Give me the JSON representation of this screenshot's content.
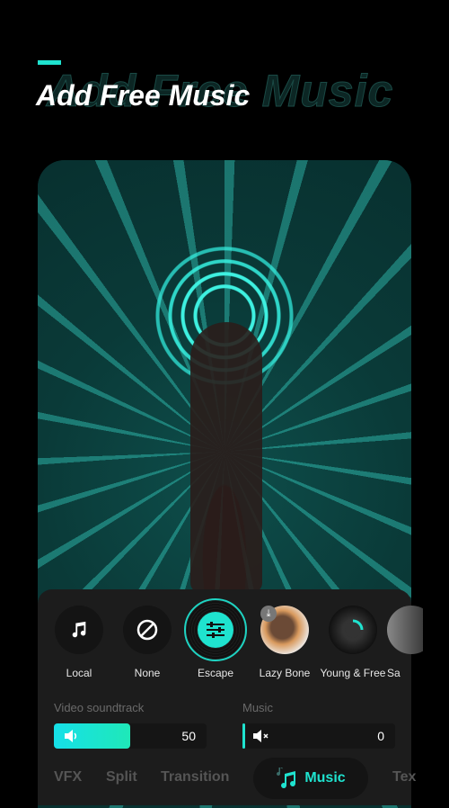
{
  "header": {
    "title": "Add Free Music",
    "ghost_title": "Add Free Music",
    "accent": "#1fe3cf"
  },
  "music_items": [
    {
      "label": "Local",
      "icon": "music-note-icon"
    },
    {
      "label": "None",
      "icon": "none-icon"
    },
    {
      "label": "Escape",
      "icon": "sliders-icon",
      "selected": true
    },
    {
      "label": "Lazy Bone",
      "icon": "download-icon"
    },
    {
      "label": "Young & Free",
      "icon": "loading-icon"
    },
    {
      "label": "Sa"
    }
  ],
  "volume": {
    "video_soundtrack": {
      "label": "Video soundtrack",
      "value": "50",
      "level": 50
    },
    "music": {
      "label": "Music",
      "value": "0",
      "level": 0
    }
  },
  "tabs": [
    {
      "label": "VFX"
    },
    {
      "label": "Split"
    },
    {
      "label": "Transition"
    },
    {
      "label": "Music",
      "active": true
    },
    {
      "label": "Tex"
    }
  ]
}
